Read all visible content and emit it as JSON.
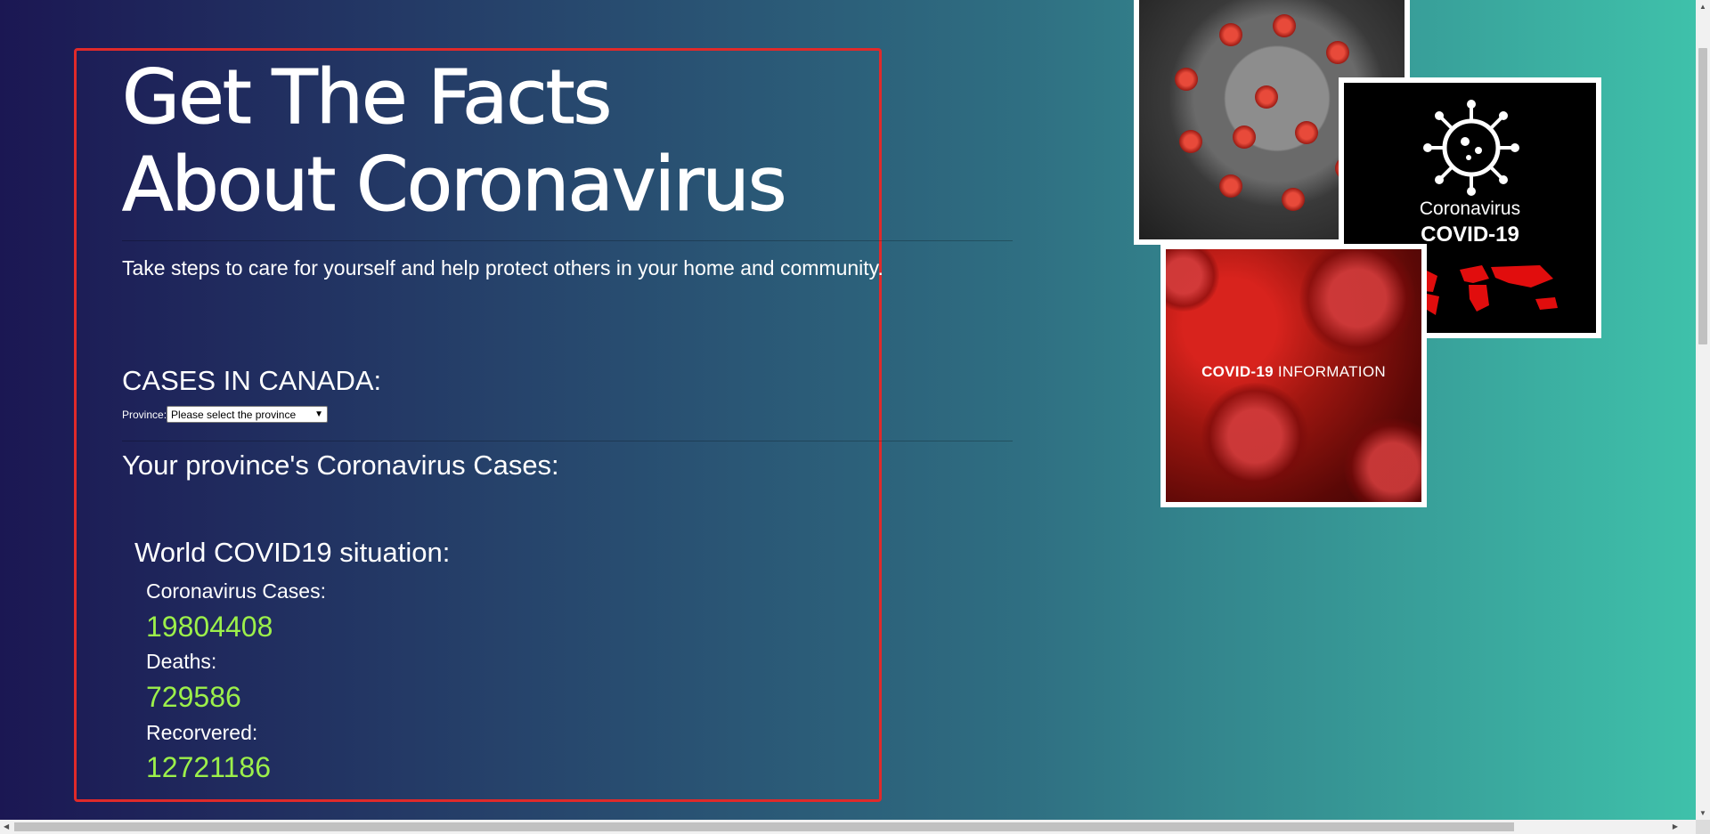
{
  "header": {
    "title": "Get The Facts About Coronavirus",
    "subtitle": "Take steps to care for yourself and help protect others in your home and community."
  },
  "canada": {
    "title": "CASES IN CANADA:",
    "province_label": "Province:",
    "province_selected": "Please select the province",
    "province_cases_title": "Your province's Coronavirus Cases:"
  },
  "world": {
    "title": "World COVID19 situation:",
    "cases_label": "Coronavirus Cases:",
    "cases_value": "19804408",
    "deaths_label": "Deaths:",
    "deaths_value": "729586",
    "recovered_label": "Recorvered:",
    "recovered_value": "12721186"
  },
  "images": {
    "black_card_line1": "Coronavirus",
    "black_card_line2": "COVID-19",
    "red_card_bold": "COVID-19",
    "red_card_rest": " INFORMATION"
  },
  "colors": {
    "accent_value": "#9cf04a",
    "panel_border": "#e02a2a"
  }
}
